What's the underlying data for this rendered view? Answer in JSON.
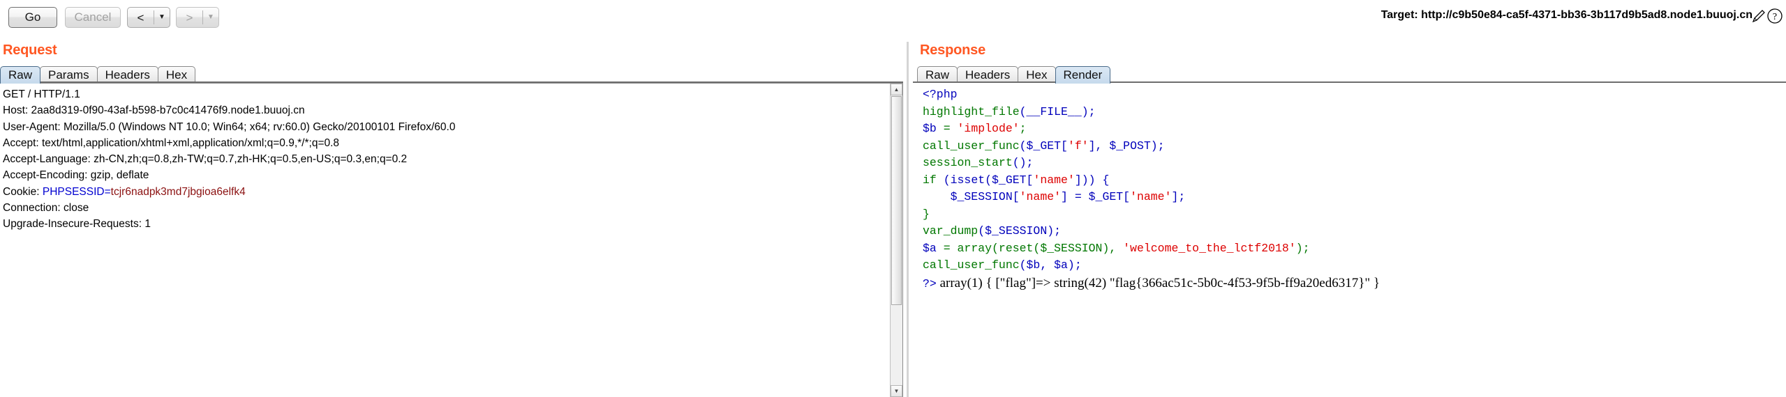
{
  "toolbar": {
    "go_label": "Go",
    "cancel_label": "Cancel",
    "back_label": "<",
    "forward_label": ">",
    "dropdown_glyph": "▼"
  },
  "target": {
    "label": "Target: http://c9b50e84-ca5f-4371-bb36-3b117d9b5ad8.node1.buuoj.cn",
    "edit_icon": "pencil-icon",
    "help_icon": "question-mark-icon"
  },
  "request": {
    "title": "Request",
    "tabs": [
      {
        "label": "Raw",
        "active": true
      },
      {
        "label": "Params",
        "active": false
      },
      {
        "label": "Headers",
        "active": false
      },
      {
        "label": "Hex",
        "active": false
      }
    ],
    "raw": {
      "line_request": "GET / HTTP/1.1",
      "line_host": "Host: 2aa8d319-0f90-43af-b598-b7c0c41476f9.node1.buuoj.cn",
      "line_user_agent": "User-Agent: Mozilla/5.0 (Windows NT 10.0; Win64; x64; rv:60.0) Gecko/20100101 Firefox/60.0",
      "line_accept": "Accept: text/html,application/xhtml+xml,application/xml;q=0.9,*/*;q=0.8",
      "line_accept_language": "Accept-Language: zh-CN,zh;q=0.8,zh-TW;q=0.7,zh-HK;q=0.5,en-US;q=0.3,en;q=0.2",
      "line_accept_encoding": "Accept-Encoding: gzip, deflate",
      "cookie_prefix": "Cookie: ",
      "cookie_name": "PHPSESSID",
      "cookie_eq": "=",
      "cookie_value": "tcjr6nadpk3md7jbgioa6elfk4",
      "line_connection": "Connection: close",
      "line_upgrade": "Upgrade-Insecure-Requests: 1"
    },
    "scrollbar": {
      "up_glyph": "▲",
      "down_glyph": "▼"
    }
  },
  "response": {
    "title": "Response",
    "tabs": [
      {
        "label": "Raw",
        "active": false
      },
      {
        "label": "Headers",
        "active": false
      },
      {
        "label": "Hex",
        "active": false
      },
      {
        "label": "Render",
        "active": true
      }
    ],
    "render": {
      "l1_open_tag": "<?php",
      "l2_highlight": "highlight_file",
      "l2_rest": "(__FILE__);",
      "l3_var": "$b",
      "l3_eq": " = ",
      "l3_str": "'implode'",
      "l3_semi": ";",
      "l4_fn": "call_user_func",
      "l4_open": "($_GET[",
      "l4_key": "'f'",
      "l4_mid": "], $_POST);",
      "l5_fn": "session_start",
      "l5_rest": "();",
      "l6_kw": "if",
      "l6_a": " (isset($_GET[",
      "l6_key": "'name'",
      "l6_b": "])) {",
      "l7_a": "    $_SESSION[",
      "l7_key1": "'name'",
      "l7_b": "] = $_GET[",
      "l7_key2": "'name'",
      "l7_c": "];",
      "l8_close": "}",
      "l9_fn": "var_dump",
      "l9_rest": "($_SESSION);",
      "l10_var": "$a",
      "l10_a": " = array(reset($_SESSION), ",
      "l10_str": "'welcome_to_the_lctf2018'",
      "l10_b": ");",
      "l11_fn": "call_user_func",
      "l11_rest": "($b, $a);",
      "l12_close_tag": "?>",
      "l12_dump": " array(1) { [\"flag\"]=> string(42) \"flag{366ac51c-5b0c-4f53-9f5b-ff9a20ed6317}\" }"
    }
  },
  "colors": {
    "panel_title": "#ff5722",
    "php_default": "#0000BB",
    "php_keyword": "#007700",
    "php_string": "#DD0000",
    "cookie_name": "#0000d0",
    "cookie_value": "#8b1010"
  }
}
